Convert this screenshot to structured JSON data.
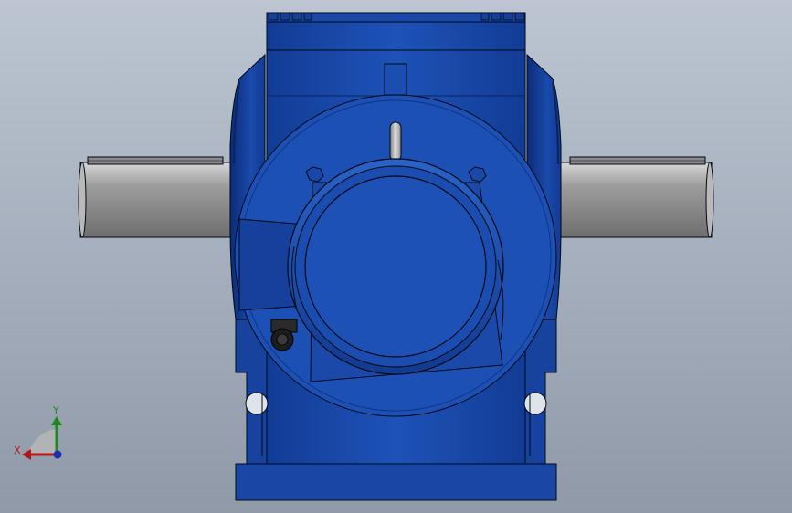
{
  "viewport": {
    "background_top": "#bcc5d1",
    "background_bottom": "#8f99a8"
  },
  "model": {
    "body_color": "#1b4cb0",
    "body_dark": "#0f2f7a",
    "outline_color": "#000814",
    "shaft_color": "#9a9a9a",
    "shaft_highlight": "#d4d4d4",
    "eyebolt_color": "#b8b8b8",
    "gland_color": "#1c1c1c"
  },
  "triad": {
    "x_label": "X",
    "y_label": "Y",
    "x_color": "#b01818",
    "y_color": "#1a8a1a",
    "z_color": "#1a2fb0",
    "origin_icon": "triad-origin-icon"
  }
}
